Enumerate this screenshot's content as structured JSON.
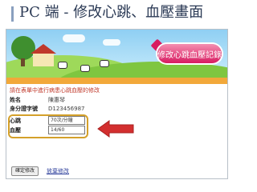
{
  "slide": {
    "title": "PC 端 - 修改心跳、血壓畫面"
  },
  "banner": {
    "badge_text": "修改心跳血壓記錄"
  },
  "form": {
    "intro": "請在表單中進行病患心跳血壓的修改",
    "name_label": "姓名",
    "name_value": "陳惠琴",
    "id_label": "身分證字號",
    "id_value": "D123456987",
    "heartbeat_label": "心跳",
    "heartbeat_value": "70次/分鐘",
    "blood_pressure_label": "血壓",
    "blood_pressure_value": "14/60",
    "submit_label": "確定修改",
    "cancel_label": "放棄修改"
  },
  "colors": {
    "accent_orange": "#f2a83a",
    "intro_red": "#c0392b",
    "arrow_red": "#d32f2f",
    "highlight_gold": "#d4a02a"
  }
}
